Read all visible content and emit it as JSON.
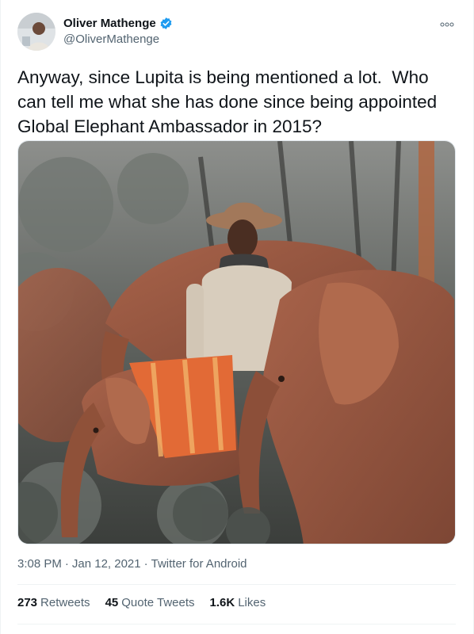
{
  "tweet": {
    "author_name": "Oliver Mathenge",
    "author_handle": "@OliverMathenge",
    "text": "Anyway, since Lupita is being mentioned a lot.  Who can tell me what she has done since being appointed Global Elephant Ambassador in 2015?",
    "time": "3:08 PM",
    "separator": "·",
    "date": "Jan 12, 2021",
    "client": "Twitter for Android"
  },
  "stats": {
    "retweets_count": "273",
    "retweets_label": "Retweets",
    "quotes_count": "45",
    "quotes_label": "Quote Tweets",
    "likes_count": "1.6K",
    "likes_label": "Likes"
  },
  "colors": {
    "verified_badge": "#1d9bf0",
    "secondary_text": "#536471",
    "primary_text": "#0f1419"
  },
  "icons": {
    "verified": "verified-badge-icon",
    "more": "more-options-icon"
  }
}
